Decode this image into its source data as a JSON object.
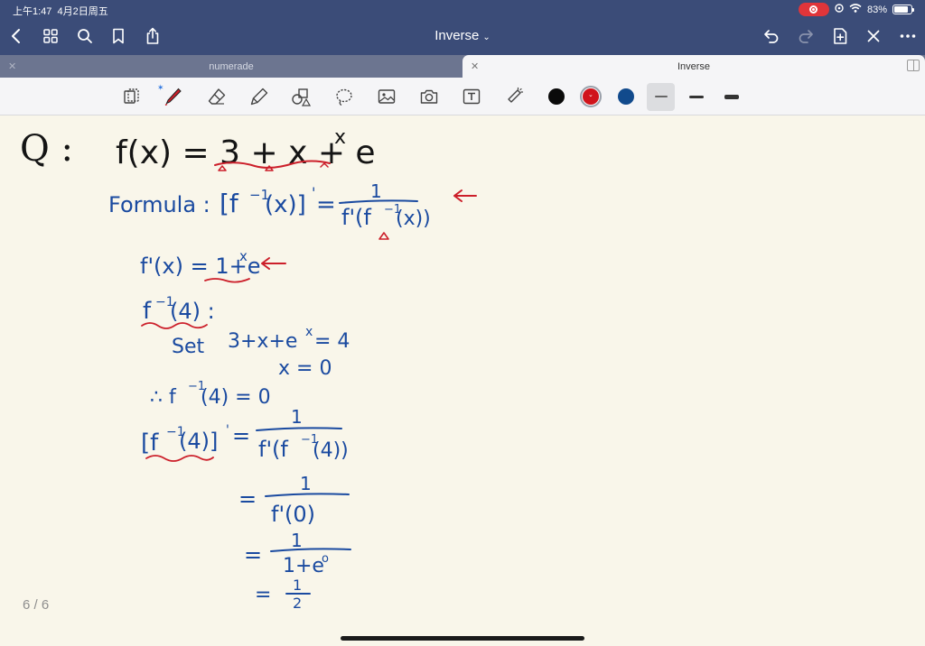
{
  "status": {
    "time": "上午1:47",
    "date": "4月2日周五",
    "battery": "83%",
    "battery_level": 0.83
  },
  "nav": {
    "title": "Inverse"
  },
  "tabs": [
    {
      "label": "numerade",
      "active": false
    },
    {
      "label": "Inverse",
      "active": true
    }
  ],
  "toolbar": {
    "tools": [
      "lasso-select-icon",
      "pen-icon",
      "eraser-icon",
      "highlighter-icon",
      "shapes-icon",
      "lasso-icon",
      "image-icon",
      "camera-icon",
      "text-icon",
      "laser-pointer-icon"
    ],
    "colors": [
      "#0a0a0a",
      "#d0141b",
      "#114a8c"
    ],
    "selected_color": "#d0141b",
    "stroke_widths": [
      "fine",
      "medium",
      "bold"
    ],
    "selected_stroke": "fine"
  },
  "page": {
    "counter": "6 / 6",
    "ink_colors": {
      "black": "#141414",
      "blue": "#1a4aa0",
      "red": "#cc1f2a"
    },
    "handwriting": {
      "question_label": "Q :",
      "function": "f(x) = 3 + x + e^x",
      "formula_label": "Formula :",
      "formula": "[f^-1(x)]' = 1 / f'(f^-1(x))",
      "derivative": "f'(x) = 1+e^x",
      "target": "f^-1(4) :",
      "set_line": "Set 3+x+e^x = 4",
      "solution": "x = 0",
      "conclusion": "∴ f^-1(4) = 0",
      "step1": "[f^-1(4)]' = 1 / f'(f^-1(4))",
      "step2": "= 1 / f'(0)",
      "step3": "= 1 / 1+e^0",
      "step4": "= 1/2"
    }
  }
}
